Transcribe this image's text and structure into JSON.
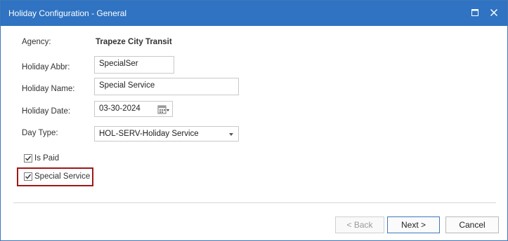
{
  "window": {
    "title": "Holiday Configuration - General"
  },
  "form": {
    "agency_label": "Agency:",
    "agency_value": "Trapeze City Transit",
    "abbr_label": "Holiday Abbr:",
    "abbr_value": "SpecialSer",
    "name_label": "Holiday Name:",
    "name_value": "Special Service",
    "date_label": "Holiday  Date:",
    "date_value": "03-30-2024",
    "daytype_label": "Day Type:",
    "daytype_value": "HOL-SERV-Holiday Service",
    "is_paid_label": "Is Paid",
    "is_paid_checked": true,
    "special_service_label": "Special Service",
    "special_service_checked": true
  },
  "buttons": {
    "back": "< Back",
    "next": "Next >",
    "cancel": "Cancel"
  },
  "colors": {
    "titlebar": "#2f73c2",
    "highlight": "#a01818"
  }
}
